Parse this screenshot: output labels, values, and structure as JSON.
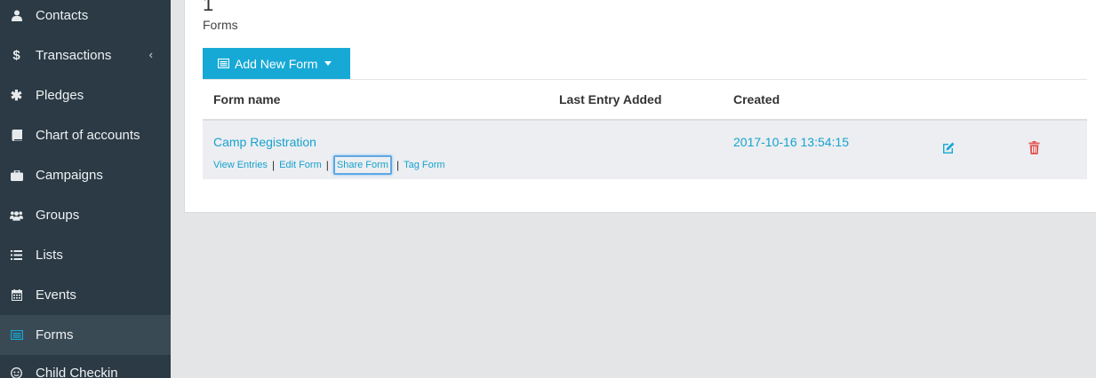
{
  "sidebar": {
    "items": [
      {
        "label": "Contacts",
        "icon": "user-icon"
      },
      {
        "label": "Transactions",
        "icon": "dollar-icon",
        "caret": "‹"
      },
      {
        "label": "Pledges",
        "icon": "asterisk-icon"
      },
      {
        "label": "Chart of accounts",
        "icon": "book-icon"
      },
      {
        "label": "Campaigns",
        "icon": "briefcase-icon"
      },
      {
        "label": "Groups",
        "icon": "users-icon"
      },
      {
        "label": "Lists",
        "icon": "list-icon"
      },
      {
        "label": "Events",
        "icon": "calendar-icon"
      },
      {
        "label": "Forms",
        "icon": "form-icon",
        "active": true
      },
      {
        "label": "Child Checkin",
        "icon": "child-icon"
      }
    ]
  },
  "summary": {
    "count": "1",
    "label": "Forms"
  },
  "toolbar": {
    "add_label": "Add New Form"
  },
  "table": {
    "headers": {
      "form_name": "Form name",
      "last_entry": "Last Entry Added",
      "created": "Created"
    },
    "rows": [
      {
        "name": "Camp Registration",
        "last_entry": "",
        "created": "2017-10-16 13:54:15",
        "actions": {
          "view": "View Entries",
          "edit": "Edit Form",
          "share": "Share Form",
          "tag": "Tag Form"
        }
      }
    ]
  },
  "colors": {
    "accent": "#17a9d6",
    "sidebar_bg": "#2b3a44",
    "danger": "#e05a5a"
  }
}
